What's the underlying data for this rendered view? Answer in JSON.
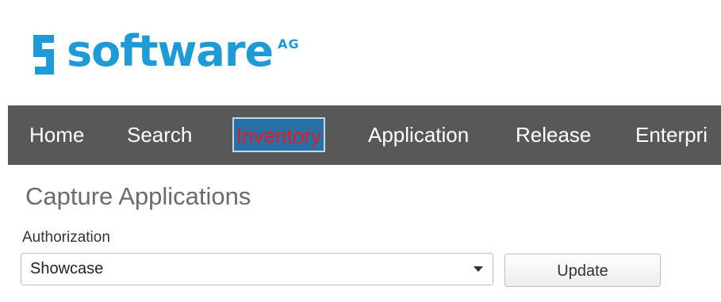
{
  "brand": {
    "logo_icon": "software-ag-s-mark-icon",
    "name": "software",
    "suffix": "AG",
    "color": "#1e9ad6"
  },
  "nav": {
    "items": [
      {
        "label": "Home"
      },
      {
        "label": "Search"
      },
      {
        "label": "Inventory",
        "active": true
      },
      {
        "label": "Application"
      },
      {
        "label": "Release"
      },
      {
        "label": "Enterpri"
      }
    ],
    "background": "#585858",
    "active_text_color": "#e31b23",
    "active_background": "#2a6fa3"
  },
  "main": {
    "title": "Capture Applications",
    "authorization": {
      "label": "Authorization",
      "selected": "Showcase"
    },
    "update_label": "Update"
  }
}
